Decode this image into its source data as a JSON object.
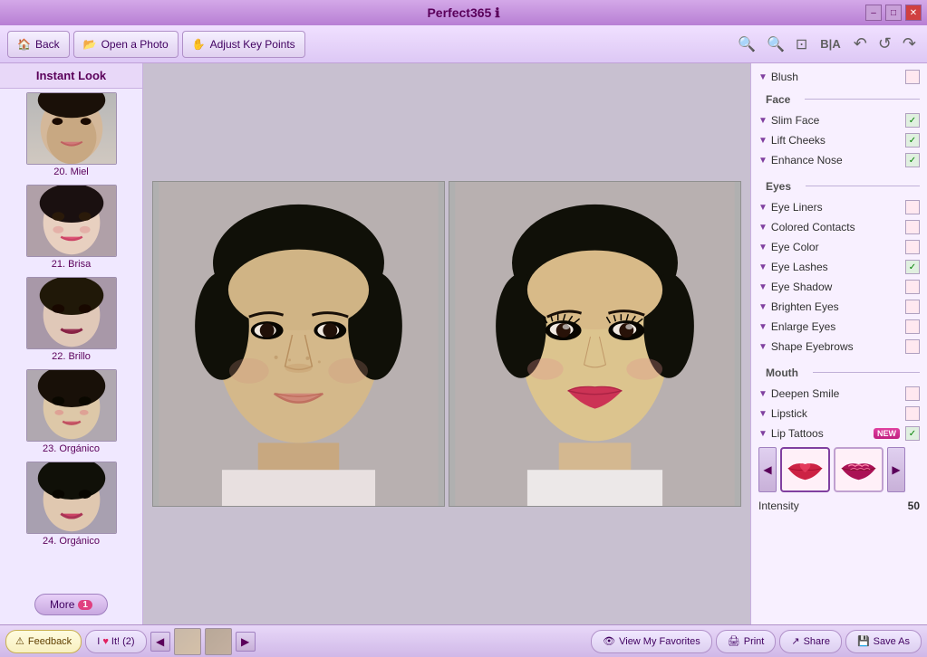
{
  "app": {
    "title": "Perfect365",
    "info_icon": "ℹ"
  },
  "titlebar": {
    "controls": [
      "🗕",
      "🗖",
      "✕"
    ]
  },
  "toolbar": {
    "back_label": "Back",
    "open_photo_label": "Open a Photo",
    "adjust_key_points_label": "Adjust Key Points",
    "bia_label": "B|A",
    "undo_icon": "↶",
    "redo_icon": "↷",
    "zoom_in_icon": "⊕",
    "zoom_out_icon": "⊖",
    "fit_icon": "⊡"
  },
  "sidebar": {
    "title": "Instant Look",
    "items": [
      {
        "id": 20,
        "label": "20. Miel"
      },
      {
        "id": 21,
        "label": "21. Brisa"
      },
      {
        "id": 22,
        "label": "22. Brillo"
      },
      {
        "id": 23,
        "label": "23. Orgánico"
      },
      {
        "id": 24,
        "label": "24. Orgánico"
      }
    ],
    "more_label": "More",
    "more_badge": "1"
  },
  "right_panel": {
    "blush_label": "Blush",
    "face_section": "Face",
    "face_items": [
      {
        "label": "Slim Face",
        "checked": true
      },
      {
        "label": "Lift Cheeks",
        "checked": true
      },
      {
        "label": "Enhance Nose",
        "checked": true
      }
    ],
    "eyes_section": "Eyes",
    "eyes_items": [
      {
        "label": "Eye Liners",
        "checked": false
      },
      {
        "label": "Colored Contacts",
        "checked": false
      },
      {
        "label": "Eye Color",
        "checked": false
      },
      {
        "label": "Eye Lashes",
        "checked": true
      },
      {
        "label": "Eye Shadow",
        "checked": false
      },
      {
        "label": "Brighten Eyes",
        "checked": false
      },
      {
        "label": "Enlarge Eyes",
        "checked": false
      },
      {
        "label": "Shape Eyebrows",
        "checked": false
      }
    ],
    "mouth_section": "Mouth",
    "mouth_items": [
      {
        "label": "Deepen Smile",
        "checked": false
      },
      {
        "label": "Lipstick",
        "checked": false
      },
      {
        "label": "Lip Tattoos",
        "checked": true,
        "new_badge": true
      }
    ],
    "intensity_label": "Intensity",
    "intensity_value": "50",
    "tattoo_prev_icon": "◀",
    "tattoo_next_icon": "▶"
  },
  "bottom": {
    "feedback_label": "Feedback",
    "love_label": "I ♥ It! (2)",
    "view_favorites_label": "View My Favorites",
    "print_label": "Print",
    "share_label": "Share",
    "save_as_label": "Save As"
  }
}
